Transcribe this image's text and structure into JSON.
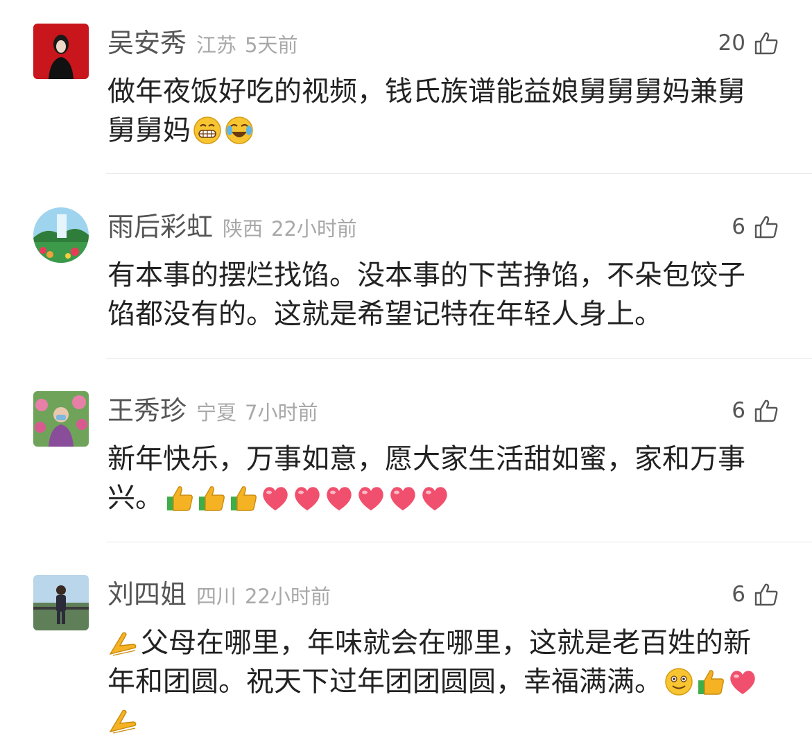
{
  "comments": [
    {
      "name": "吴安秀",
      "location": "江苏",
      "time": "5天前",
      "likes": "20",
      "avatar": "avatar-red-woman",
      "lines": [
        {
          "text": "做年夜饭好吃的视频，钱氏族谱能益娘舅舅舅妈兼舅",
          "emojis": []
        },
        {
          "text": "舅舅妈",
          "emojis": [
            "grin-emoji",
            "laugh-cry-emoji"
          ]
        }
      ]
    },
    {
      "name": "雨后彩虹",
      "location": "陕西",
      "time": "22小时前",
      "likes": "6",
      "avatar": "avatar-landscape-painting",
      "lines": [
        {
          "text": "有本事的摆烂找馅。没本事的下苦挣馅，不朵包饺子",
          "emojis": []
        },
        {
          "text": "馅都没有的。这就是希望记特在年轻人身上。",
          "emojis": []
        }
      ]
    },
    {
      "name": "王秀珍",
      "location": "宁夏",
      "time": "7小时前",
      "likes": "6",
      "avatar": "avatar-woman-mask-flowers",
      "lines": [
        {
          "text": "新年快乐，万事如意，愿大家生活甜如蜜，家和万事",
          "emojis": []
        },
        {
          "text": "兴。",
          "emojis": [
            "thumbs-up-emoji",
            "thumbs-up-emoji",
            "thumbs-up-emoji",
            "heart-emoji",
            "heart-emoji",
            "heart-emoji",
            "heart-emoji",
            "heart-emoji",
            "heart-emoji"
          ]
        }
      ]
    },
    {
      "name": "刘四姐",
      "location": "四川",
      "time": "22小时前",
      "likes": "6",
      "avatar": "avatar-person-outdoors",
      "lines": [
        {
          "text": "父母在哪里，年味就会在哪里，这就是老百姓的新",
          "emojis": [],
          "lead": "pray-emoji"
        },
        {
          "text": "年和团圆。祝天下过年团团圆圆，幸福满满。",
          "emojis": [
            "smile-emoji",
            "thumbs-up-emoji",
            "heart-emoji"
          ]
        },
        {
          "text": "",
          "emojis": [
            "pray-emoji"
          ]
        }
      ]
    }
  ],
  "colors": {
    "name": "#555555",
    "meta": "#a8a8a8",
    "text": "#222222",
    "divider": "#e6e6e6",
    "heart": "#f0506e",
    "thumb": "#f5b324"
  }
}
